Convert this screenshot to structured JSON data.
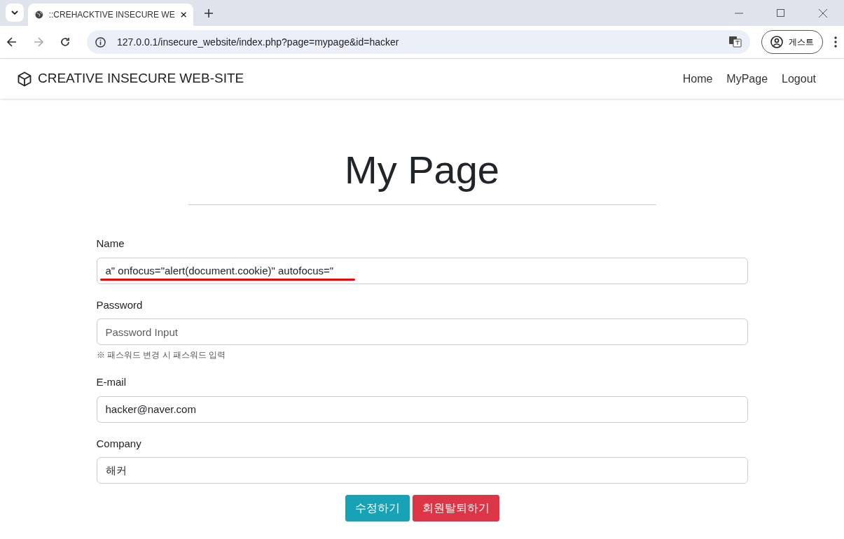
{
  "browser": {
    "tab_title": "::CREHACKTIVE INSECURE WE",
    "url": "127.0.0.1/insecure_website/index.php?page=mypage&id=hacker",
    "profile_label": "게스트"
  },
  "navbar": {
    "brand": "CREATIVE INSECURE WEB-SITE",
    "links": [
      {
        "label": "Home"
      },
      {
        "label": "MyPage"
      },
      {
        "label": "Logout"
      }
    ]
  },
  "heading": "My Page",
  "fields": [
    {
      "label": "Name",
      "value": "a\" onfocus=\"alert(document.cookie)\" autofocus=\"",
      "underlined": true
    },
    {
      "label": "Password",
      "placeholder": "Password Input",
      "hint": "※ 패스워드 변경 시 패스워드 입력",
      "underlined": false
    },
    {
      "label": "E-mail",
      "value": "hacker@naver.com",
      "underlined": false
    },
    {
      "label": "Company",
      "value": "해커",
      "underlined": false
    }
  ],
  "buttons": [
    {
      "label": "수정하기",
      "kind": "info"
    },
    {
      "label": "회원탈퇴하기",
      "kind": "danger"
    }
  ]
}
